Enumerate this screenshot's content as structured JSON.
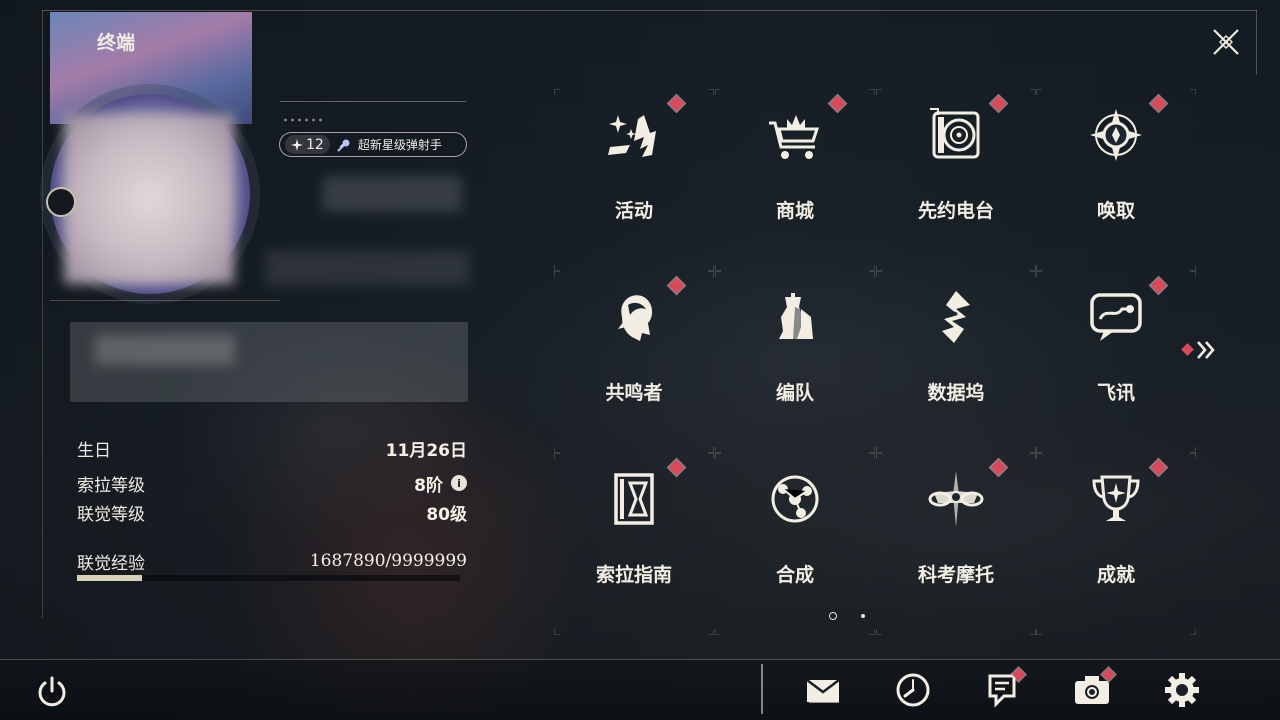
{
  "header": {
    "title": "终端",
    "logo_icon": "diamond-cluster-icon",
    "close_icon": "close-x-icon"
  },
  "profile": {
    "star_level": "12",
    "star_icon": "sparkle-icon",
    "title_badge": "超新星级弹射手",
    "title_icon": "comet-icon",
    "stats": [
      {
        "label": "生日",
        "value": "11月26日"
      },
      {
        "label": "索拉等级",
        "value": "8阶"
      },
      {
        "label": "联觉等级",
        "value": "80级"
      }
    ],
    "experience": {
      "label": "联觉经验",
      "value": "1687890/9999999",
      "fill_fraction": 0.169
    },
    "info_glyph": "i"
  },
  "menu": {
    "items": [
      {
        "label": "活动",
        "icon": "sparkle-stripes-icon",
        "badge": true
      },
      {
        "label": "商城",
        "icon": "shopping-cart-icon",
        "badge": true
      },
      {
        "label": "先约电台",
        "icon": "radio-speaker-icon",
        "badge": true
      },
      {
        "label": "唤取",
        "icon": "compass-star-icon",
        "badge": true
      },
      {
        "label": "共鸣者",
        "icon": "character-head-icon",
        "badge": true
      },
      {
        "label": "编队",
        "icon": "chess-pieces-icon",
        "badge": false
      },
      {
        "label": "数据坞",
        "icon": "data-dock-icon",
        "badge": false
      },
      {
        "label": "飞讯",
        "icon": "chat-bubble-icon",
        "badge": true
      },
      {
        "label": "索拉指南",
        "icon": "guide-book-icon",
        "badge": true
      },
      {
        "label": "合成",
        "icon": "synthesis-ring-icon",
        "badge": false
      },
      {
        "label": "科考摩托",
        "icon": "motorbike-icon",
        "badge": true
      },
      {
        "label": "成就",
        "icon": "trophy-icon",
        "badge": true
      }
    ],
    "next_page_icon": "double-chevron-right-icon",
    "page_count": 2,
    "current_page": 1
  },
  "bottom_bar": {
    "power_icon": "power-icon",
    "buttons": [
      {
        "icon": "mail-icon",
        "badge": false
      },
      {
        "icon": "clock-icon",
        "badge": false
      },
      {
        "icon": "notice-icon",
        "badge": true
      },
      {
        "icon": "camera-icon",
        "badge": true
      },
      {
        "icon": "settings-gear-icon",
        "badge": false
      }
    ]
  },
  "colors": {
    "badge": "#d84a5a",
    "accent": "#d9cfb6",
    "text": "#f2eee4",
    "exp_value": "#c8b99a"
  }
}
